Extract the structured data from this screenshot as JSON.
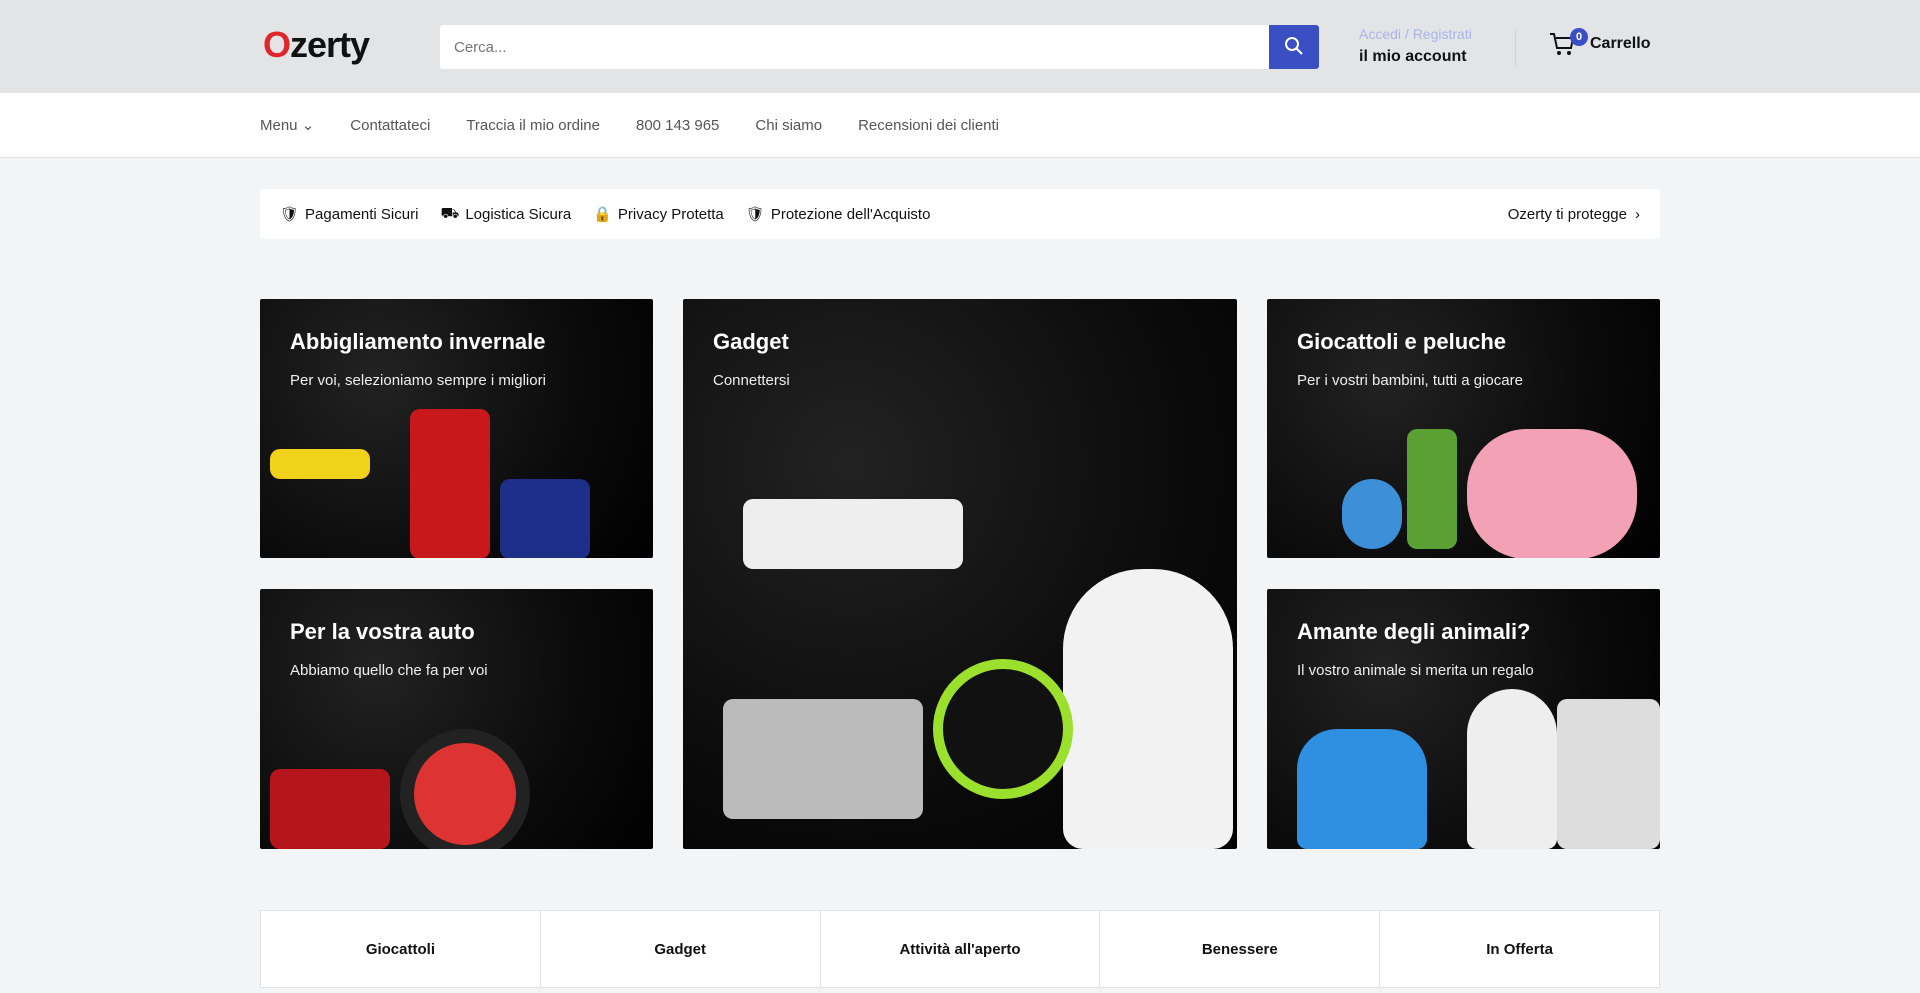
{
  "header": {
    "logo": "Ozerty",
    "search_placeholder": "Cerca...",
    "account_login": "Accedi / Registrati",
    "account_label": "il mio account",
    "cart_count": "0",
    "cart_label": "Carrello"
  },
  "nav": [
    "Menu",
    "Contattateci",
    "Traccia il mio ordine",
    "800 143 965",
    "Chi siamo",
    "Recensioni dei clienti"
  ],
  "trust": {
    "items": [
      "Pagamenti Sicuri",
      "Logistica Sicura",
      "Privacy Protetta",
      "Protezione dell'Acquisto"
    ],
    "link": "Ozerty ti protegge"
  },
  "cards": [
    {
      "title": "Abbigliamento invernale",
      "subtitle": "Per voi, selezioniamo sempre i migliori"
    },
    {
      "title": "Gadget",
      "subtitle": "Connettersi"
    },
    {
      "title": "Giocattoli e peluche",
      "subtitle": "Per i vostri bambini, tutti a giocare"
    },
    {
      "title": "Per la vostra auto",
      "subtitle": "Abbiamo quello che fa per voi"
    },
    {
      "title": "Amante degli animali?",
      "subtitle": "Il vostro animale si merita un regalo"
    }
  ],
  "tabs": [
    "Giocattoli",
    "Gadget",
    "Attività all'aperto",
    "Benessere",
    "In Offerta"
  ],
  "colors": {
    "accent": "#3b4fc4",
    "brand_red": "#e0262b"
  }
}
